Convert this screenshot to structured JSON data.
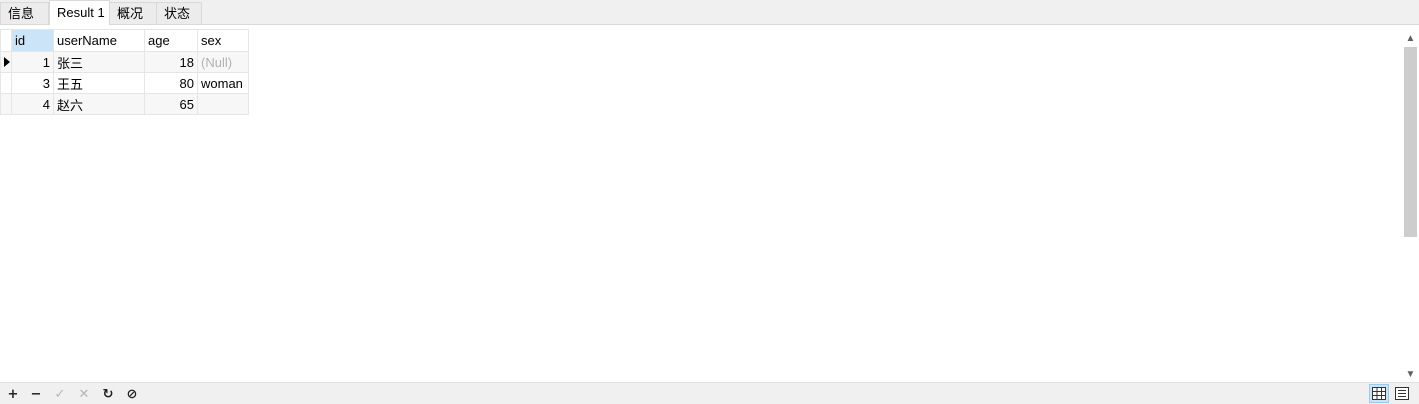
{
  "tabs": [
    {
      "label": "信息"
    },
    {
      "label": "Result 1",
      "active": true
    },
    {
      "label": "概况"
    },
    {
      "label": "状态"
    }
  ],
  "grid": {
    "columns": [
      "id",
      "userName",
      "age",
      "sex"
    ],
    "selected_column": "id",
    "rows": [
      {
        "id": "1",
        "userName": "张三",
        "age": "18",
        "sex": "(Null)",
        "sex_is_null": true,
        "current": true
      },
      {
        "id": "3",
        "userName": "王五",
        "age": "80",
        "sex": "woman"
      },
      {
        "id": "4",
        "userName": "赵六",
        "age": "65",
        "sex": ""
      }
    ]
  },
  "scrollbar": {
    "up_arrow": "▲",
    "down_arrow": "▼"
  },
  "toolbar": {
    "add": "+",
    "delete": "−",
    "apply": "✓",
    "discard": "✕",
    "refresh": "↻",
    "stop": "⊘"
  },
  "colors": {
    "selected_header": "#cce4f7",
    "null_text": "#b2b2b2",
    "alt_row": "#f7f7f7"
  }
}
